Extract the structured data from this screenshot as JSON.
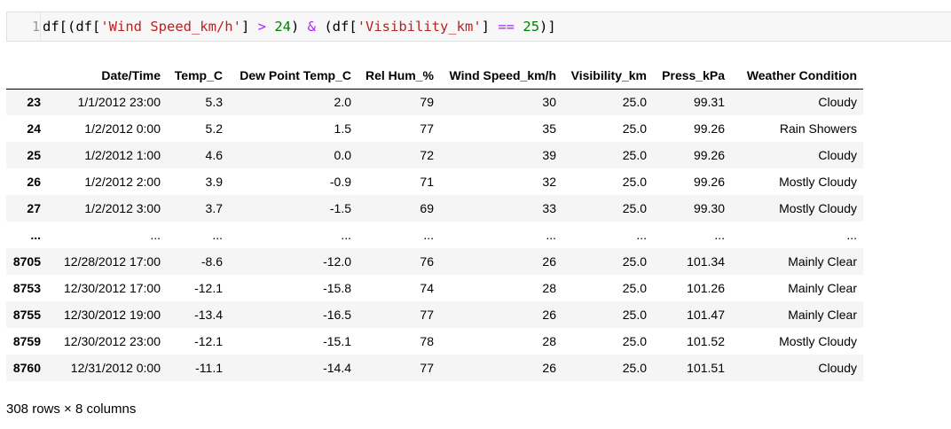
{
  "code_cell": {
    "line_number": "1",
    "tokens": [
      {
        "text": "df[(df[",
        "kind": "plain"
      },
      {
        "text": "'Wind Speed_km/h'",
        "kind": "str"
      },
      {
        "text": "] ",
        "kind": "plain"
      },
      {
        "text": ">",
        "kind": "op"
      },
      {
        "text": " ",
        "kind": "plain"
      },
      {
        "text": "24",
        "kind": "num"
      },
      {
        "text": ") ",
        "kind": "plain"
      },
      {
        "text": "&",
        "kind": "op"
      },
      {
        "text": " (df[",
        "kind": "plain"
      },
      {
        "text": "'Visibility_km'",
        "kind": "str"
      },
      {
        "text": "] ",
        "kind": "plain"
      },
      {
        "text": "==",
        "kind": "op"
      },
      {
        "text": " ",
        "kind": "plain"
      },
      {
        "text": "25",
        "kind": "num"
      },
      {
        "text": ")]",
        "kind": "plain"
      }
    ]
  },
  "table": {
    "columns": [
      "",
      "Date/Time",
      "Temp_C",
      "Dew Point Temp_C",
      "Rel Hum_%",
      "Wind Speed_km/h",
      "Visibility_km",
      "Press_kPa",
      "Weather Condition"
    ],
    "rows": [
      [
        "23",
        "1/1/2012 23:00",
        "5.3",
        "2.0",
        "79",
        "30",
        "25.0",
        "99.31",
        "Cloudy"
      ],
      [
        "24",
        "1/2/2012 0:00",
        "5.2",
        "1.5",
        "77",
        "35",
        "25.0",
        "99.26",
        "Rain Showers"
      ],
      [
        "25",
        "1/2/2012 1:00",
        "4.6",
        "0.0",
        "72",
        "39",
        "25.0",
        "99.26",
        "Cloudy"
      ],
      [
        "26",
        "1/2/2012 2:00",
        "3.9",
        "-0.9",
        "71",
        "32",
        "25.0",
        "99.26",
        "Mostly Cloudy"
      ],
      [
        "27",
        "1/2/2012 3:00",
        "3.7",
        "-1.5",
        "69",
        "33",
        "25.0",
        "99.30",
        "Mostly Cloudy"
      ],
      [
        "...",
        "...",
        "...",
        "...",
        "...",
        "...",
        "...",
        "...",
        "..."
      ],
      [
        "8705",
        "12/28/2012 17:00",
        "-8.6",
        "-12.0",
        "76",
        "26",
        "25.0",
        "101.34",
        "Mainly Clear"
      ],
      [
        "8753",
        "12/30/2012 17:00",
        "-12.1",
        "-15.8",
        "74",
        "28",
        "25.0",
        "101.26",
        "Mainly Clear"
      ],
      [
        "8755",
        "12/30/2012 19:00",
        "-13.4",
        "-16.5",
        "77",
        "26",
        "25.0",
        "101.47",
        "Mainly Clear"
      ],
      [
        "8759",
        "12/30/2012 23:00",
        "-12.1",
        "-15.1",
        "78",
        "28",
        "25.0",
        "101.52",
        "Mostly Cloudy"
      ],
      [
        "8760",
        "12/31/2012 0:00",
        "-11.1",
        "-14.4",
        "77",
        "26",
        "25.0",
        "101.51",
        "Cloudy"
      ]
    ]
  },
  "shape_text": "308 rows × 8 columns"
}
